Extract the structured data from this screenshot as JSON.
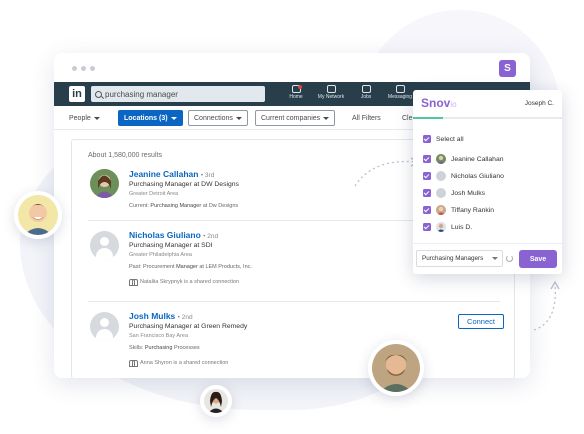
{
  "browser": {
    "extension_badge": "S"
  },
  "linkedin": {
    "logo": "in",
    "search_value": "purchasing manager",
    "nav": [
      {
        "label": "Home"
      },
      {
        "label": "My Network"
      },
      {
        "label": "Jobs"
      },
      {
        "label": "Messaging"
      }
    ],
    "filters": {
      "people": "People",
      "locations": "Locations (3)",
      "connections": "Connections",
      "current_companies": "Current companies",
      "all_filters": "All Filters",
      "clear": "Cle"
    },
    "result_count": "About 1,580,000 results",
    "results": [
      {
        "name": "Jeanine Callahan",
        "degree": "• 3rd",
        "title": "Purchasing Manager at DW Designs",
        "location": "Greater Detroit Area",
        "extra_prefix": "Current: ",
        "extra_bold": "Purchasing Manager",
        "extra_suffix": " at Dw Designs",
        "shared": ""
      },
      {
        "name": "Nicholas Giuliano",
        "degree": "• 2nd",
        "title": "Purchasing Manager at SDI",
        "location": "Greater Philadelphia Area",
        "extra_prefix": "Past: Procurement ",
        "extra_bold": "Manager",
        "extra_suffix": " at LEM Products, Inc.",
        "shared": "Nataliia Skrypnyk is a shared connection"
      },
      {
        "name": "Josh Mulks",
        "degree": "• 2nd",
        "title": "Purchasing Manager at Green Remedy",
        "location": "San Francisco Bay Area",
        "extra_prefix": "Skills: ",
        "extra_bold": "Purchasing",
        "extra_suffix": " Processes",
        "shared": "Anna Shyron is a shared connection",
        "connect_label": "Connect"
      }
    ]
  },
  "snov": {
    "logo": "Snov",
    "logo_suffix": "io",
    "user": "Joseph C.",
    "progress": 0.2,
    "select_all": "Select all",
    "people": [
      "Jeanine Callahan",
      "Nicholas Giuliano",
      "Josh Mulks",
      "Tiffany Rankin",
      "Luis D."
    ],
    "list_name": "Purchasing Managers",
    "save_label": "Save"
  },
  "colors": {
    "linkedin_bar": "#283e4a",
    "linkedin_blue": "#0a66c2",
    "snov_purple": "#8a63d2",
    "progress_green": "#4cc9a3"
  },
  "icons": [
    "search-icon",
    "home-icon",
    "network-icon",
    "jobs-icon",
    "messaging-icon",
    "caret-down-icon",
    "checkbox-icon",
    "refresh-icon",
    "shared-connection-icon"
  ]
}
